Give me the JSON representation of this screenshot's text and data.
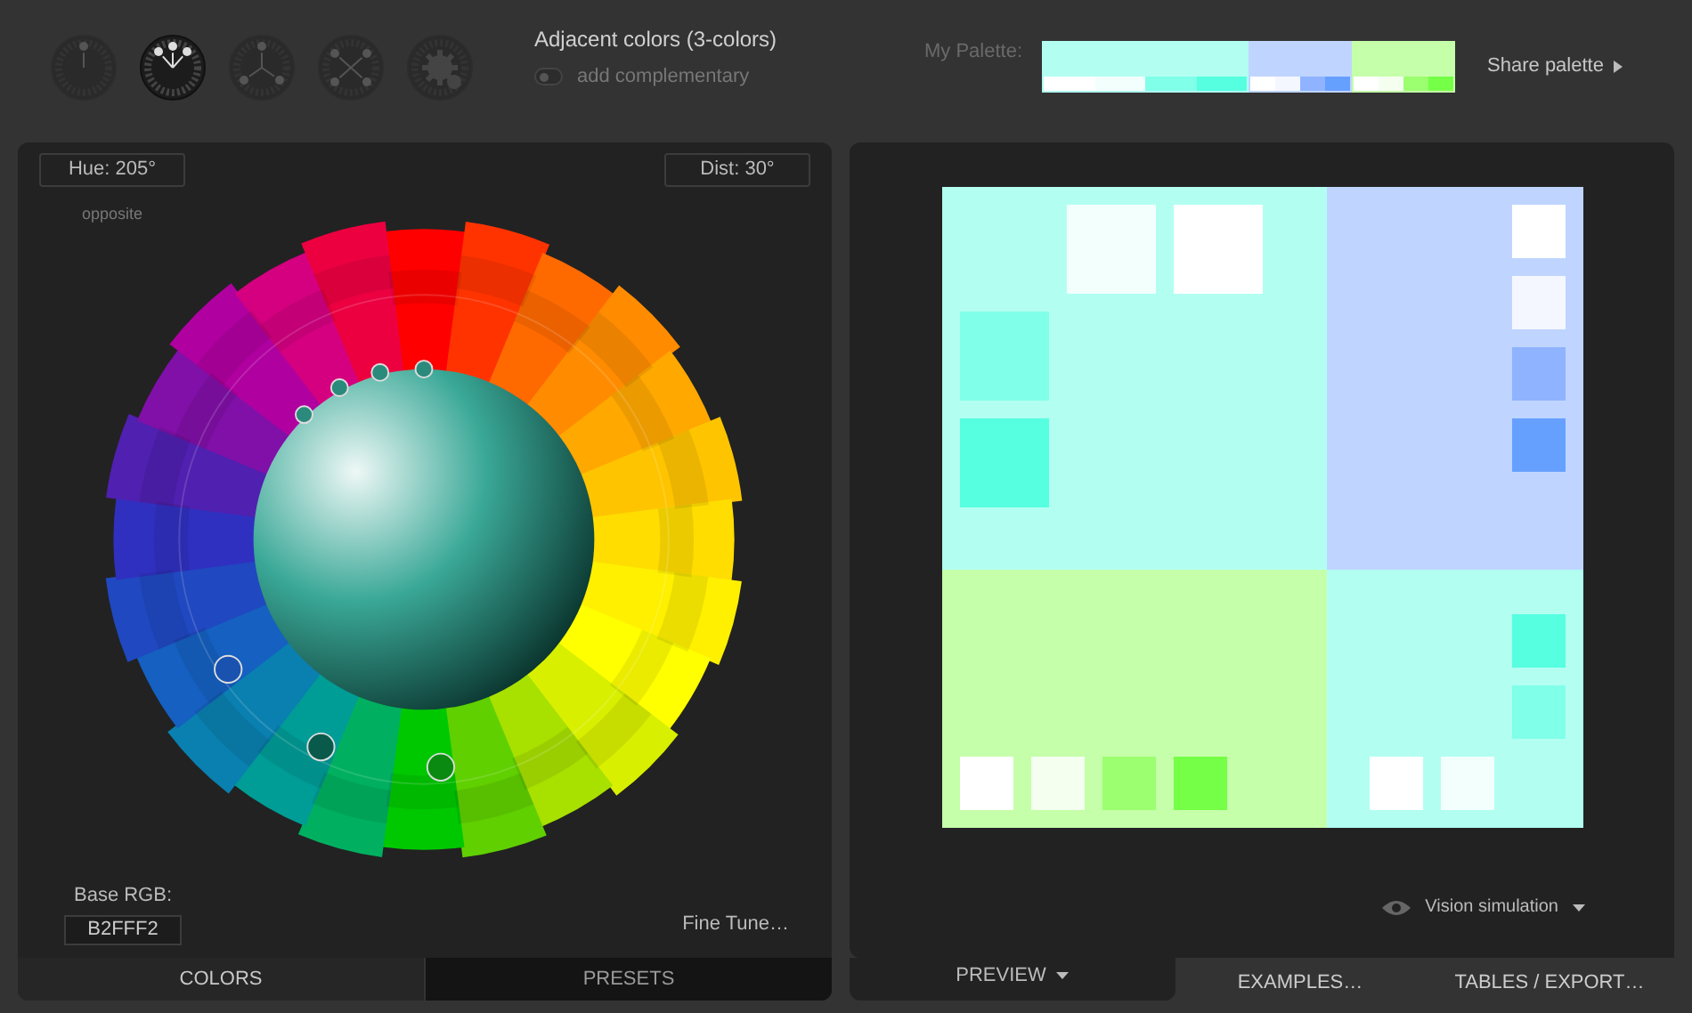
{
  "modes": [
    {
      "kind": "mono",
      "selected": false
    },
    {
      "kind": "adjacent",
      "selected": true
    },
    {
      "kind": "triad",
      "selected": false
    },
    {
      "kind": "tetrad",
      "selected": false
    },
    {
      "kind": "custom",
      "selected": false
    }
  ],
  "scheme": {
    "title": "Adjacent colors (3-colors)",
    "complementary": {
      "label": "add complementary",
      "on": false
    }
  },
  "hue_field": "Hue: 205°",
  "opposite": "opposite",
  "dist_field": "Dist: 30°",
  "base_rgb": {
    "label": "Base RGB:",
    "value": "B2FFF2"
  },
  "fine_tune": "Fine Tune…",
  "left_tabs": [
    {
      "label": "COLORS",
      "selected": true
    },
    {
      "label": "PRESETS",
      "selected": false
    }
  ],
  "palette": {
    "label": "My Palette:",
    "share": "Share palette",
    "groups": [
      {
        "color": "#b2fff2",
        "shades": [
          {
            "color": "#ffffff"
          },
          {
            "color": "#f2fffd"
          },
          {
            "color": "#80ffe9"
          },
          {
            "color": "#55ffe0"
          }
        ]
      },
      {
        "color": "#bfd5ff",
        "shades": [
          {
            "color": "#ffffff"
          },
          {
            "color": "#f4f7ff"
          },
          {
            "color": "#8fb3ff"
          },
          {
            "color": "#66a0ff"
          }
        ]
      },
      {
        "color": "#c5ffaa",
        "shades": [
          {
            "color": "#ffffff"
          },
          {
            "color": "#f4fff0"
          },
          {
            "color": "#9bff6f"
          },
          {
            "color": "#75ff46"
          }
        ]
      }
    ]
  },
  "vision": "Vision simulation",
  "right_tabs": [
    {
      "label": "PREVIEW",
      "selected": true
    },
    {
      "label": "EXAMPLES…",
      "selected": false
    },
    {
      "label": "TABLES / EXPORT…",
      "selected": false
    }
  ]
}
